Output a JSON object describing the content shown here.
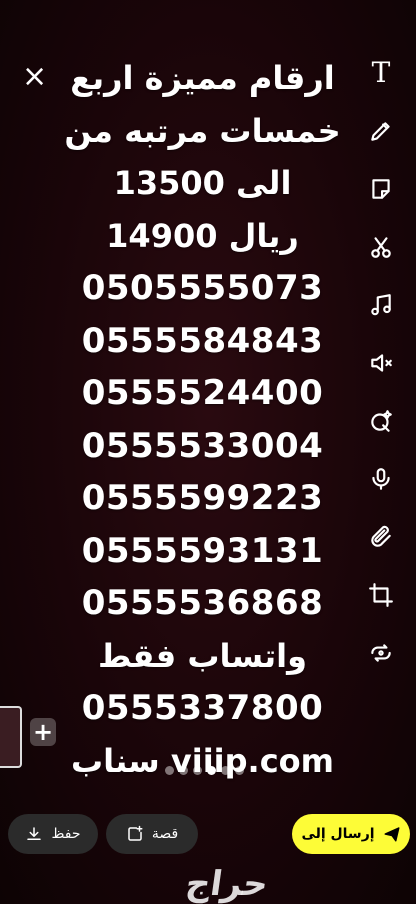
{
  "close_icon": "×",
  "post_text": {
    "lines": [
      "ارقام مميزة اربع",
      "خمسات مرتبه من",
      "13500 الى",
      "14900 ريال",
      "0505555073",
      "0555584843",
      "0555524400",
      "0555533004",
      "0555599223",
      "0555593131",
      "0555536868",
      "واتساب فقط",
      "0555337800",
      "سناب viiip.com"
    ]
  },
  "toolbar": {
    "text_glyph": "T",
    "icons": [
      "text-icon",
      "pencil-icon",
      "sticker-icon",
      "scissors-icon",
      "music-icon",
      "mute-icon",
      "magic-icon",
      "mic-icon",
      "paperclip-icon",
      "crop-icon",
      "loop-icon"
    ]
  },
  "plus_label": "+",
  "bottom": {
    "save_label": "حفظ",
    "story_label": "قصة",
    "send_label": "إرسال إلى"
  },
  "watermark": "حراج",
  "colors": {
    "send_button": "#fdfc37",
    "background": "#1a0509"
  }
}
